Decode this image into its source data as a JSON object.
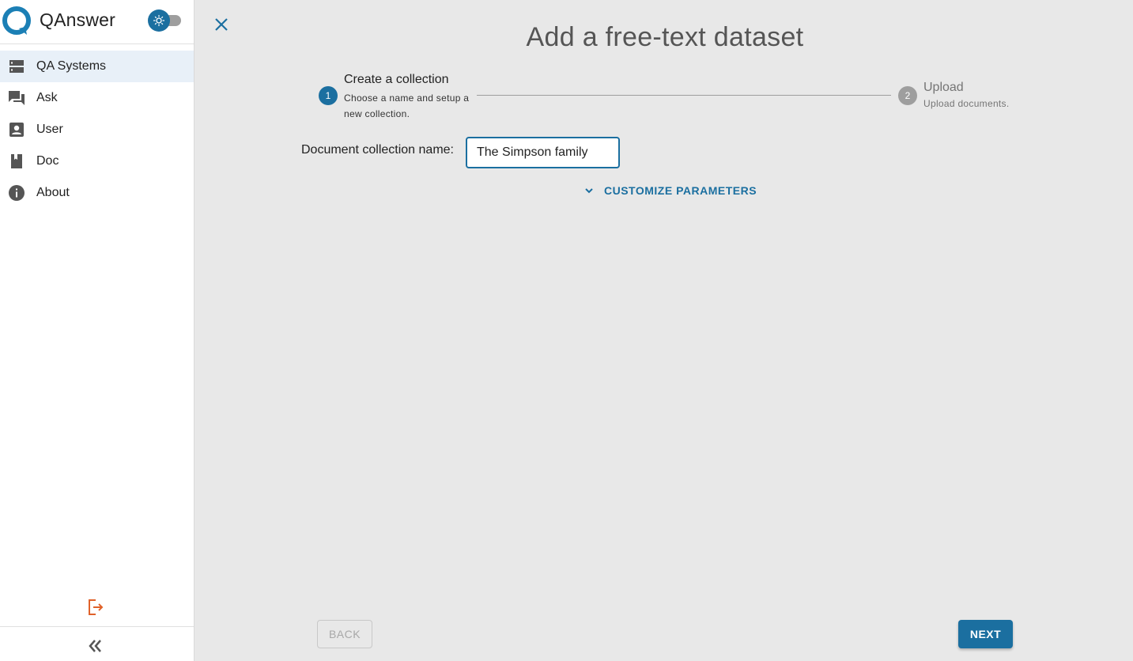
{
  "app": {
    "name": "QAnswer",
    "logo_icon": "qanswer-logo-icon",
    "theme_toggle_icon": "sun-icon"
  },
  "sidebar": {
    "items": [
      {
        "label": "QA Systems",
        "icon": "server-icon",
        "active": true
      },
      {
        "label": "Ask",
        "icon": "chat-bubbles-icon",
        "active": false
      },
      {
        "label": "User",
        "icon": "account-box-icon",
        "active": false
      },
      {
        "label": "Doc",
        "icon": "book-icon",
        "active": false
      },
      {
        "label": "About",
        "icon": "info-icon",
        "active": false
      }
    ],
    "logout_icon": "logout-icon",
    "collapse_icon": "double-chevron-left-icon"
  },
  "page": {
    "title": "Add a free-text dataset",
    "close_icon": "close-icon"
  },
  "stepper": {
    "steps": [
      {
        "number": "1",
        "title": "Create a collection",
        "description": "Choose a name and setup a new collection.",
        "active": true
      },
      {
        "number": "2",
        "title": "Upload",
        "description": "Upload documents.",
        "active": false
      }
    ]
  },
  "form": {
    "collection_name_label": "Document collection name:",
    "collection_name_value": "The Simpson family",
    "customize_label": "CUSTOMIZE PARAMETERS",
    "customize_icon": "chevron-down-icon"
  },
  "actions": {
    "back_label": "BACK",
    "next_label": "NEXT"
  },
  "colors": {
    "primary": "#1b6fa0",
    "logout": "#e0622a",
    "inactive": "#9e9e9e",
    "background": "#e8e8e8"
  }
}
